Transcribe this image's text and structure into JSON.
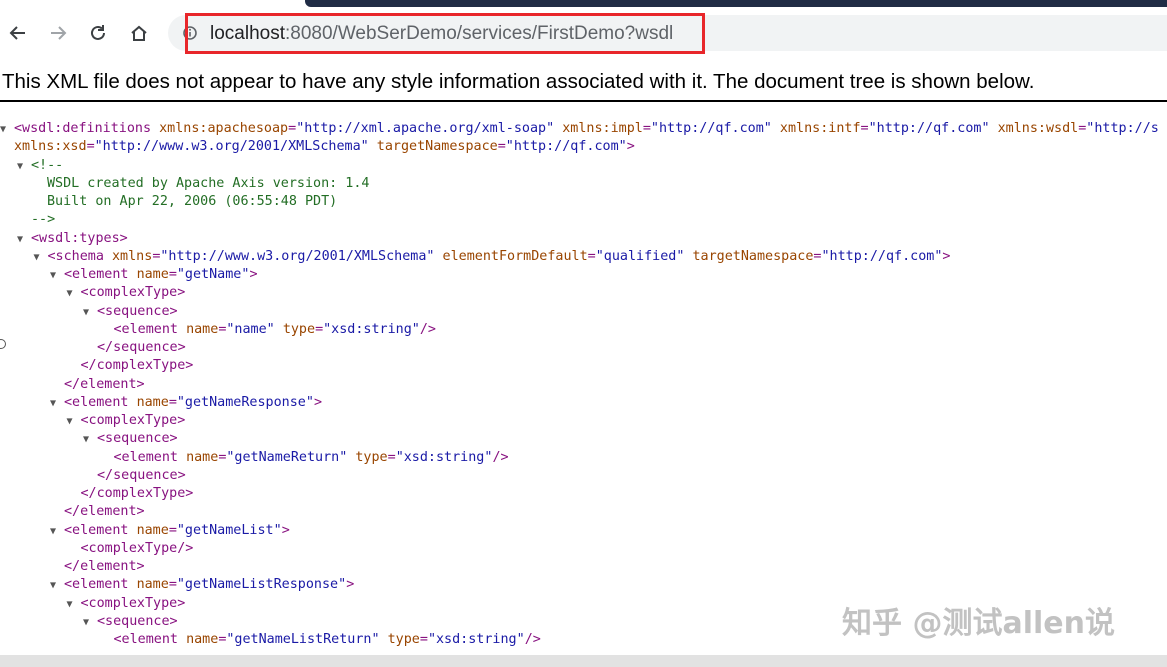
{
  "browser": {
    "url_host": "localhost",
    "url_rest": ":8080/WebSerDemo/services/FirstDemo?wsdl",
    "highlight_color": "#e8262a"
  },
  "info_message": "This XML file does not appear to have any style information associated with it. The document tree is shown below.",
  "tree_lines": [
    {
      "toggle": "▼",
      "parts": [
        [
          "tg",
          "<wsdl:definitions "
        ],
        [
          "an",
          "xmlns:apachesoap"
        ],
        [
          "tg",
          "="
        ],
        [
          "av",
          "\"http://xml.apache.org/xml-soap\""
        ],
        [
          "tg",
          " "
        ],
        [
          "an",
          "xmlns:impl"
        ],
        [
          "tg",
          "="
        ],
        [
          "av",
          "\"http://qf.com\""
        ],
        [
          "tg",
          " "
        ],
        [
          "an",
          "xmlns:intf"
        ],
        [
          "tg",
          "="
        ],
        [
          "av",
          "\"http://qf.com\""
        ],
        [
          "tg",
          " "
        ],
        [
          "an",
          "xmlns:wsdl"
        ],
        [
          "tg",
          "="
        ],
        [
          "av",
          "\"http://s"
        ]
      ]
    },
    {
      "toggle": "",
      "parts": [
        [
          "an",
          "xmlns:xsd"
        ],
        [
          "tg",
          "="
        ],
        [
          "av",
          "\"http://www.w3.org/2001/XMLSchema\""
        ],
        [
          "tg",
          " "
        ],
        [
          "an",
          "targetNamespace"
        ],
        [
          "tg",
          "="
        ],
        [
          "av",
          "\"http://qf.com\""
        ],
        [
          "tg",
          ">"
        ]
      ]
    },
    {
      "toggle": "▼",
      "parts": [
        [
          "cm",
          "<!--"
        ]
      ]
    },
    {
      "toggle": "",
      "parts": [
        [
          "cm",
          "WSDL created by Apache Axis version: 1.4"
        ]
      ]
    },
    {
      "toggle": "",
      "parts": [
        [
          "cm",
          "Built on Apr 22, 2006 (06:55:48 PDT)"
        ]
      ]
    },
    {
      "toggle": "",
      "parts": [
        [
          "cm",
          "-->"
        ]
      ]
    },
    {
      "toggle": "▼",
      "parts": [
        [
          "tg",
          "<wsdl:types>"
        ]
      ]
    },
    {
      "toggle": "▼",
      "parts": [
        [
          "tg",
          "<schema "
        ],
        [
          "an",
          "xmlns"
        ],
        [
          "tg",
          "="
        ],
        [
          "av",
          "\"http://www.w3.org/2001/XMLSchema\""
        ],
        [
          "tg",
          " "
        ],
        [
          "an",
          "elementFormDefault"
        ],
        [
          "tg",
          "="
        ],
        [
          "av",
          "\"qualified\""
        ],
        [
          "tg",
          " "
        ],
        [
          "an",
          "targetNamespace"
        ],
        [
          "tg",
          "="
        ],
        [
          "av",
          "\"http://qf.com\""
        ],
        [
          "tg",
          ">"
        ]
      ]
    },
    {
      "toggle": "▼",
      "parts": [
        [
          "tg",
          "<element "
        ],
        [
          "an",
          "name"
        ],
        [
          "tg",
          "="
        ],
        [
          "av",
          "\"getName\""
        ],
        [
          "tg",
          ">"
        ]
      ]
    },
    {
      "toggle": "▼",
      "parts": [
        [
          "tg",
          "<complexType>"
        ]
      ]
    },
    {
      "toggle": "▼",
      "parts": [
        [
          "tg",
          "<sequence>"
        ]
      ]
    },
    {
      "toggle": "",
      "parts": [
        [
          "tg",
          "<element "
        ],
        [
          "an",
          "name"
        ],
        [
          "tg",
          "="
        ],
        [
          "av",
          "\"name\""
        ],
        [
          "tg",
          " "
        ],
        [
          "an",
          "type"
        ],
        [
          "tg",
          "="
        ],
        [
          "av",
          "\"xsd:string\""
        ],
        [
          "tg",
          "/>"
        ]
      ]
    },
    {
      "toggle": "",
      "parts": [
        [
          "tg",
          "</sequence>"
        ]
      ]
    },
    {
      "toggle": "",
      "parts": [
        [
          "tg",
          "</complexType>"
        ]
      ]
    },
    {
      "toggle": "",
      "parts": [
        [
          "tg",
          "</element>"
        ]
      ]
    },
    {
      "toggle": "▼",
      "parts": [
        [
          "tg",
          "<element "
        ],
        [
          "an",
          "name"
        ],
        [
          "tg",
          "="
        ],
        [
          "av",
          "\"getNameResponse\""
        ],
        [
          "tg",
          ">"
        ]
      ]
    },
    {
      "toggle": "▼",
      "parts": [
        [
          "tg",
          "<complexType>"
        ]
      ]
    },
    {
      "toggle": "▼",
      "parts": [
        [
          "tg",
          "<sequence>"
        ]
      ]
    },
    {
      "toggle": "",
      "parts": [
        [
          "tg",
          "<element "
        ],
        [
          "an",
          "name"
        ],
        [
          "tg",
          "="
        ],
        [
          "av",
          "\"getNameReturn\""
        ],
        [
          "tg",
          " "
        ],
        [
          "an",
          "type"
        ],
        [
          "tg",
          "="
        ],
        [
          "av",
          "\"xsd:string\""
        ],
        [
          "tg",
          "/>"
        ]
      ]
    },
    {
      "toggle": "",
      "parts": [
        [
          "tg",
          "</sequence>"
        ]
      ]
    },
    {
      "toggle": "",
      "parts": [
        [
          "tg",
          "</complexType>"
        ]
      ]
    },
    {
      "toggle": "",
      "parts": [
        [
          "tg",
          "</element>"
        ]
      ]
    },
    {
      "toggle": "▼",
      "parts": [
        [
          "tg",
          "<element "
        ],
        [
          "an",
          "name"
        ],
        [
          "tg",
          "="
        ],
        [
          "av",
          "\"getNameList\""
        ],
        [
          "tg",
          ">"
        ]
      ]
    },
    {
      "toggle": "",
      "parts": [
        [
          "tg",
          "<complexType/>"
        ]
      ]
    },
    {
      "toggle": "",
      "parts": [
        [
          "tg",
          "</element>"
        ]
      ]
    },
    {
      "toggle": "▼",
      "parts": [
        [
          "tg",
          "<element "
        ],
        [
          "an",
          "name"
        ],
        [
          "tg",
          "="
        ],
        [
          "av",
          "\"getNameListResponse\""
        ],
        [
          "tg",
          ">"
        ]
      ]
    },
    {
      "toggle": "▼",
      "parts": [
        [
          "tg",
          "<complexType>"
        ]
      ]
    },
    {
      "toggle": "▼",
      "parts": [
        [
          "tg",
          "<sequence>"
        ]
      ]
    },
    {
      "toggle": "",
      "parts": [
        [
          "tg",
          "<element "
        ],
        [
          "an",
          "name"
        ],
        [
          "tg",
          "="
        ],
        [
          "av",
          "\"getNameListReturn\""
        ],
        [
          "tg",
          " "
        ],
        [
          "an",
          "type"
        ],
        [
          "tg",
          "="
        ],
        [
          "av",
          "\"xsd:string\""
        ],
        [
          "tg",
          "/>"
        ]
      ]
    }
  ],
  "watermark": "知乎 @测试allen说"
}
